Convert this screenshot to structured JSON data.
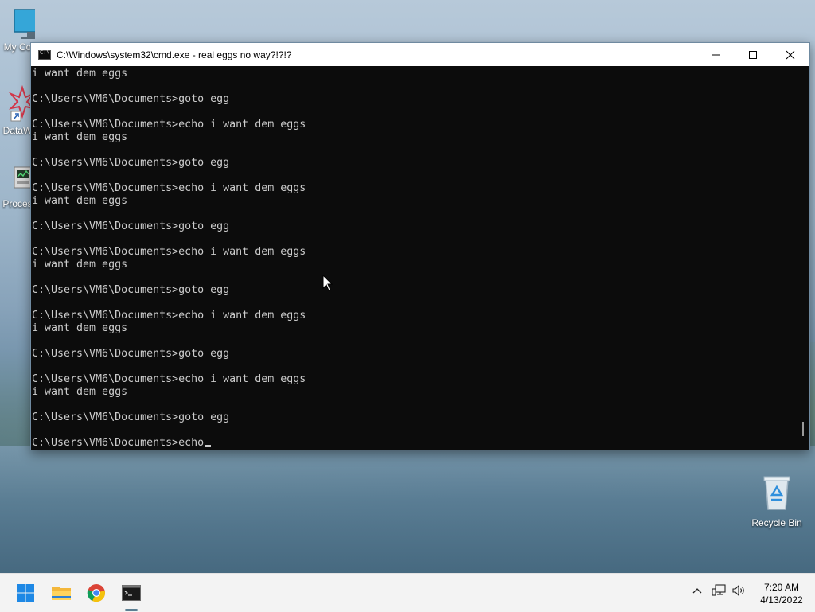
{
  "desktop": {
    "icons": [
      {
        "label": "My Co",
        "icon": "monitor-icon"
      },
      {
        "label": "DataW",
        "icon": "datawarrior-icon"
      },
      {
        "label": "Proces",
        "icon": "process-icon"
      }
    ],
    "recycle_bin": {
      "label": "Recycle Bin",
      "icon": "recycle-bin-icon"
    }
  },
  "window": {
    "title": "C:\\Windows\\system32\\cmd.exe - real  eggs no way?!?!?",
    "controls": {
      "minimize": "minimize-icon",
      "maximize": "maximize-icon",
      "close": "close-icon"
    }
  },
  "console": {
    "lines": [
      "i want dem eggs",
      "",
      "C:\\Users\\VM6\\Documents>goto egg",
      "",
      "C:\\Users\\VM6\\Documents>echo i want dem eggs",
      "i want dem eggs",
      "",
      "C:\\Users\\VM6\\Documents>goto egg",
      "",
      "C:\\Users\\VM6\\Documents>echo i want dem eggs",
      "i want dem eggs",
      "",
      "C:\\Users\\VM6\\Documents>goto egg",
      "",
      "C:\\Users\\VM6\\Documents>echo i want dem eggs",
      "i want dem eggs",
      "",
      "C:\\Users\\VM6\\Documents>goto egg",
      "",
      "C:\\Users\\VM6\\Documents>echo i want dem eggs",
      "i want dem eggs",
      "",
      "C:\\Users\\VM6\\Documents>goto egg",
      "",
      "C:\\Users\\VM6\\Documents>echo i want dem eggs",
      "i want dem eggs",
      "",
      "C:\\Users\\VM6\\Documents>goto egg",
      ""
    ],
    "current_line": "C:\\Users\\VM6\\Documents>echo"
  },
  "taskbar": {
    "buttons": [
      "start-icon",
      "file-explorer-icon",
      "chrome-icon",
      "cmd-icon"
    ],
    "tray_icons": [
      "chevron-up-icon",
      "network-icon",
      "volume-icon"
    ],
    "time": "7:20 AM",
    "date": "4/13/2022"
  },
  "colors": {
    "console_bg": "#0c0c0c",
    "console_fg": "#cccccc",
    "taskbar_bg": "#f3f3f3"
  }
}
